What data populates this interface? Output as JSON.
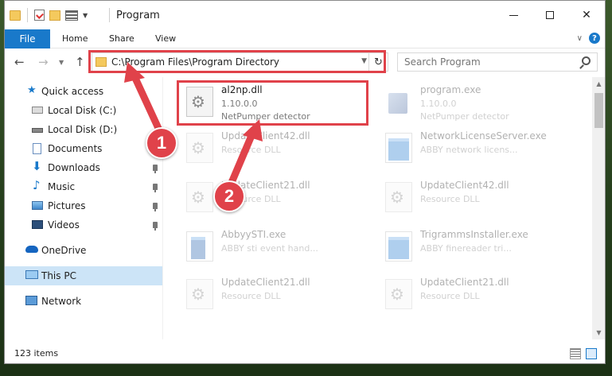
{
  "window": {
    "title": "Program"
  },
  "ribbon": {
    "file_tab": "File",
    "tabs": [
      "Home",
      "Share",
      "View"
    ],
    "help": "?"
  },
  "navbar": {
    "address": "C:\\Program Files\\Program Directory",
    "search_placeholder": "Search Program"
  },
  "sidebar": {
    "items": [
      {
        "label": "Quick access",
        "icon": "star-icon"
      },
      {
        "label": "Local Disk (C:)",
        "icon": "drive-icon"
      },
      {
        "label": "Local Disk (D:)",
        "icon": "drive-icon"
      },
      {
        "label": "Documents",
        "icon": "document-icon",
        "pinned": true
      },
      {
        "label": "Downloads",
        "icon": "download-icon",
        "pinned": true
      },
      {
        "label": "Music",
        "icon": "music-icon",
        "pinned": true
      },
      {
        "label": "Pictures",
        "icon": "picture-icon",
        "pinned": true
      },
      {
        "label": "Videos",
        "icon": "video-icon",
        "pinned": true
      },
      {
        "label": "OneDrive",
        "icon": "cloud-icon"
      },
      {
        "label": "This PC",
        "icon": "computer-icon",
        "selected": true
      },
      {
        "label": "Network",
        "icon": "network-icon"
      }
    ]
  },
  "files": [
    {
      "name": "al2np.dll",
      "line2": "1.10.0.0",
      "line3": "NetPumper detector",
      "type": "dll"
    },
    {
      "name": "program.exe",
      "line2": "1.10.0.0",
      "line3": "NetPumper detector",
      "type": "pkg"
    },
    {
      "name": "UpdateClient42.dll",
      "line2": "Resource DLL",
      "line3": "",
      "type": "dll"
    },
    {
      "name": "NetworkLicenseServer.exe",
      "line2": "ABBY network licens...",
      "line3": "",
      "type": "exe"
    },
    {
      "name": "UpdateClient21.dll",
      "line2": "Resource DLL",
      "line3": "",
      "type": "dll"
    },
    {
      "name": "UpdateClient42.dll",
      "line2": "Resource DLL",
      "line3": "",
      "type": "dll"
    },
    {
      "name": "AbbyySTI.exe",
      "line2": "ABBY sti event hand...",
      "line3": "",
      "type": "exe"
    },
    {
      "name": "TrigrammsInstaller.exe",
      "line2": "ABBY finereader tri...",
      "line3": "",
      "type": "exe"
    },
    {
      "name": "UpdateClient21.dll",
      "line2": "Resource DLL",
      "line3": "",
      "type": "dll"
    },
    {
      "name": "UpdateClient21.dll",
      "line2": "Resource DLL",
      "line3": "",
      "type": "dll"
    }
  ],
  "status": {
    "item_count": "123 items"
  },
  "annotations": {
    "step1": "1",
    "step2": "2"
  },
  "colors": {
    "accent": "#1979ca",
    "highlight": "#e0424a",
    "selected": "#cce4f7"
  }
}
